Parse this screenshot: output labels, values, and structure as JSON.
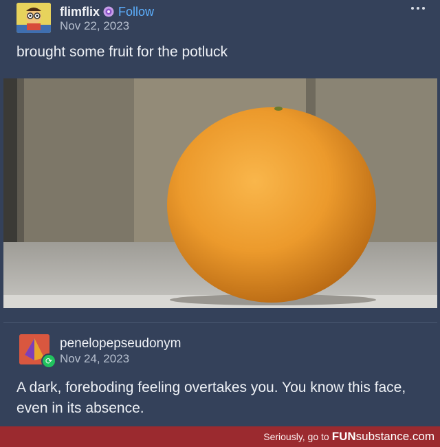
{
  "post1": {
    "username": "flimflix",
    "follow_label": "Follow",
    "date": "Nov 22, 2023",
    "caption": "brought some fruit for the potluck"
  },
  "post2": {
    "username": "penelopepseudonym",
    "date": "Nov 24, 2023",
    "caption": "A dark, foreboding feeling overtakes you. You know this face, even in its absence."
  },
  "footer": {
    "text": "Seriously, go to",
    "logo_bold": "FUN",
    "logo_rest": "substance.com"
  },
  "icons": {
    "more": "more-dots-icon",
    "badge": "purple-badge-icon",
    "reblog": "reblog-icon"
  },
  "colors": {
    "background": "#34415a",
    "follow": "#5db0ff",
    "footer": "#9b2a2f",
    "reblog": "#21c25e"
  }
}
